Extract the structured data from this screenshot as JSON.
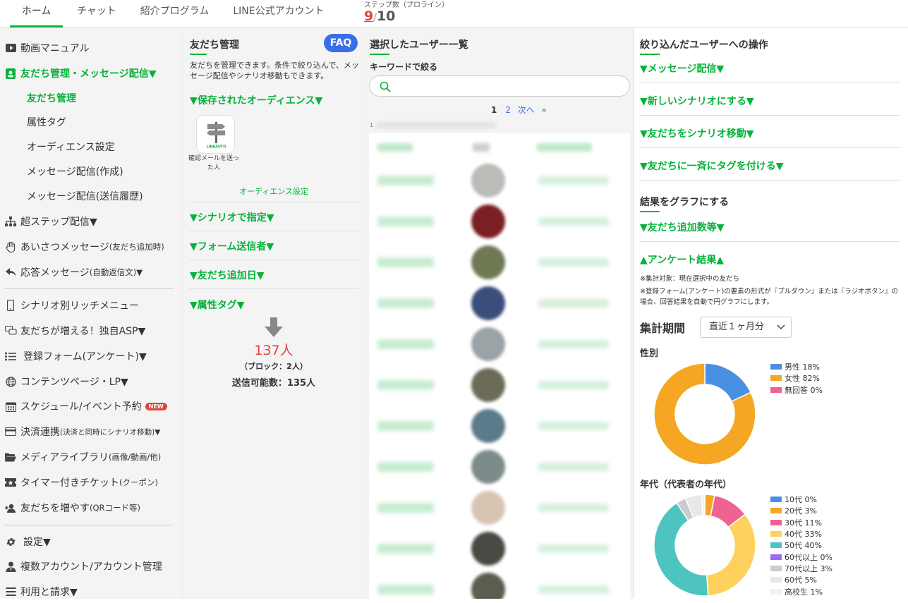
{
  "topbar": {
    "tabs": [
      {
        "label": "ホーム"
      },
      {
        "label": "チャット"
      },
      {
        "label": "紹介プログラム"
      },
      {
        "label": "LINE公式アカウント"
      }
    ],
    "step_label": "ステップ数（プロライン）",
    "step_used": "9",
    "step_sep": "/",
    "step_total": "10"
  },
  "sidebar": {
    "video_manual": "動画マニュアル",
    "friends_msg": "友だち管理・メッセージ配信▼",
    "sub": {
      "friends": "友だち管理",
      "tags": "属性タグ",
      "audience": "オーディエンス設定",
      "msg_create": "メッセージ配信(作成)",
      "msg_history": "メッセージ配信(送信履歴)"
    },
    "super_step": "超ステップ配信▼",
    "greeting": "あいさつメッセージ",
    "greeting_note": "(友だち追加時)",
    "reply": "応答メッセージ",
    "reply_note": "(自動返信文)▼",
    "rich_menu": "シナリオ別リッチメニュー",
    "asp": "友だちが増える！独自ASP▼",
    "form": "登録フォーム(アンケート)▼",
    "content": "コンテンツページ・LP▼",
    "schedule": "スケジュール/イベント予約",
    "new_badge": "NEW",
    "payment": "決済連携",
    "payment_note": "(決済と同時にシナリオ移動)▼",
    "media": "メディアライブラリ",
    "media_note": "(画像/動画/他)",
    "ticket": "タイマー付きチケット",
    "ticket_note": "(クーポン)",
    "increase": "友だちを増やす",
    "increase_note": "(QRコード等)",
    "settings": "設定▼",
    "accounts": "複数アカウント/アカウント管理",
    "billing": "利用と請求▼"
  },
  "friends_panel": {
    "title": "友だち管理",
    "faq": "FAQ",
    "desc": "友だちを管理できます。条件で絞り込んで、メッセージ配信やシナリオ移動もできます。",
    "saved_audience": "▼保存されたオーディエンス▼",
    "card_logo": "LINEAUTO",
    "card_label": "確認メールを送った人",
    "audience_setting": "オーディエンス設定",
    "scenario": "▼シナリオで指定▼",
    "form_sender": "▼フォーム送信者▼",
    "add_date": "▼友だち追加日▼",
    "attr_tag": "▼属性タグ▼",
    "count": "137人",
    "blocked": "（ブロック：2人）",
    "sendable": "送信可能数：135人"
  },
  "users_panel": {
    "title": "選択したユーザー一覧",
    "keyword_label": "キーワードで絞る",
    "search_placeholder": "",
    "page_current": "1",
    "page_next_num": "2",
    "page_next": "次へ",
    "page_last": "»",
    "row_count_hint": "1"
  },
  "ops_panel": {
    "title": "絞り込んだユーザーへの操作",
    "message": "▼メッセージ配信▼",
    "new_scenario": "▼新しいシナリオにする▼",
    "move_scenario": "▼友だちをシナリオ移動▼",
    "bulk_tag": "▼友だちに一斉にタグを付ける▼",
    "graph_title": "結果をグラフにする",
    "add_count": "▼友だち追加数等▼",
    "survey": "▲アンケート結果▲",
    "note1": "※集計対象：現在選択中の友だち",
    "note2": "※登録フォーム(アンケート)の要素の形式が『プルダウン』または『ラジオボタン』の場合、回答結果を自動で円グラフにします。",
    "period_label": "集計期間",
    "period_value": "直近１ヶ月分"
  },
  "chart_data": [
    {
      "type": "pie",
      "title": "性別",
      "categories": [
        "男性",
        "女性",
        "無回答"
      ],
      "values": [
        18,
        82,
        0
      ],
      "legend_labels": [
        "男性 18%",
        "女性 82%",
        "無回答 0%"
      ],
      "colors": [
        "#4a90e2",
        "#f5a623",
        "#f06292"
      ]
    },
    {
      "type": "pie",
      "title": "年代（代表者の年代）",
      "categories": [
        "10代",
        "20代",
        "30代",
        "40代",
        "50代",
        "60代以上",
        "70代以上",
        "60代",
        "高校生"
      ],
      "values": [
        0,
        3,
        11,
        33,
        40,
        0,
        3,
        5,
        1
      ],
      "legend_labels": [
        "10代 0%",
        "20代 3%",
        "30代 11%",
        "40代 33%",
        "50代 40%",
        "60代以上 0%",
        "70代以上 3%",
        "60代 5%",
        "高校生 1%"
      ],
      "colors": [
        "#4a90e2",
        "#f5a623",
        "#f06292",
        "#fdd15c",
        "#4dc4c0",
        "#9b6cf0",
        "#c9cbcf",
        "#e8e8e8",
        "#f2f2f2"
      ]
    }
  ]
}
